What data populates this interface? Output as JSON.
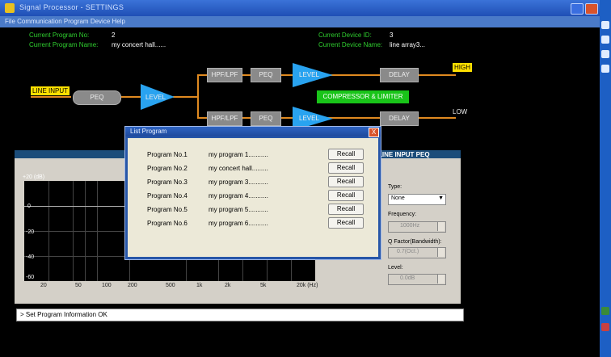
{
  "window": {
    "title": "Signal Processor - SETTINGS"
  },
  "menubar": {
    "text": "File  Communication  Program  Device  Help"
  },
  "info": {
    "program_no_label": "Current Program No:",
    "program_no_value": "2",
    "program_name_label": "Current Program Name:",
    "program_name_value": "my concert hall......",
    "device_id_label": "Current Device ID:",
    "device_id_value": "3",
    "device_name_label": "Current Device Name:",
    "device_name_value": "line array3..."
  },
  "flow": {
    "line_input": "LINE INPUT",
    "peq": "PEQ",
    "level": "LEVEL",
    "hpf_lpf": "HPF/LPF",
    "level2": "LEVEL",
    "delay": "DELAY",
    "high": "HIGH",
    "low": "LOW",
    "compressor": "COMPRESSOR & LIMITER",
    "hpf_lpf_b": "HPF/LPF",
    "peq_b": "PEQ",
    "level_b": "LEVEL",
    "delay_b": "DELAY"
  },
  "peq_panel": {
    "title": "LINE INPUT PEQ",
    "y_labels": [
      "+20 (dB)",
      "0",
      "-20",
      "-40",
      "-60"
    ],
    "x_labels": [
      "20",
      "50",
      "100",
      "200",
      "500",
      "1k",
      "2k",
      "5k",
      "20k (Hz)"
    ],
    "type_label": "Type:",
    "type_value": "None",
    "frequency_label": "Frequency:",
    "frequency_value": "1000Hz",
    "q_label": "Q Factor(Bandwidth):",
    "q_value": "0.7(Oct.)",
    "level_label": "Level:",
    "level_value": "0.0dB"
  },
  "status": {
    "text": "> Set Program Information OK"
  },
  "dialog": {
    "title": "List Program",
    "close": "X",
    "recall_label": "Recall",
    "programs": [
      {
        "no": "Program No.1",
        "name": "my program 1..........."
      },
      {
        "no": "Program No.2",
        "name": "my concert hall........."
      },
      {
        "no": "Program No.3",
        "name": "my program 3..........."
      },
      {
        "no": "Program No.4",
        "name": "my program 4..........."
      },
      {
        "no": "Program No.5",
        "name": "my program 5..........."
      },
      {
        "no": "Program No.6",
        "name": "my program 6..........."
      }
    ]
  }
}
